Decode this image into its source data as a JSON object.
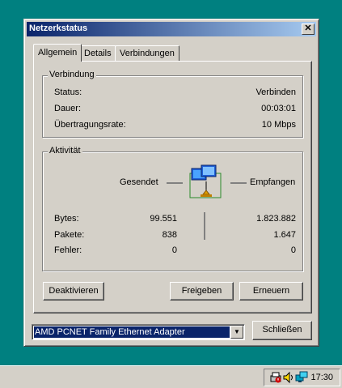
{
  "window": {
    "title": "Netzerkstatus"
  },
  "tabs": [
    {
      "label": "Allgemein"
    },
    {
      "label": "Details"
    },
    {
      "label": "Verbindungen"
    }
  ],
  "verbindung": {
    "title": "Verbindung",
    "rows": [
      {
        "label": "Status:",
        "value": "Verbinden"
      },
      {
        "label": "Dauer:",
        "value": "00:03:01"
      },
      {
        "label": "Übertragungsrate:",
        "value": "10 Mbps"
      }
    ]
  },
  "aktivitaet": {
    "title": "Aktivität",
    "sent_label": "Gesendet",
    "received_label": "Empfangen",
    "rows": [
      {
        "label": "Bytes:",
        "sent": "99.551",
        "received": "1.823.882"
      },
      {
        "label": "Pakete:",
        "sent": "838",
        "received": "1.647"
      },
      {
        "label": "Fehler:",
        "sent": "0",
        "received": "0"
      }
    ]
  },
  "buttons": {
    "deactivate": "Deaktivieren",
    "share": "Freigeben",
    "renew": "Erneuern",
    "close": "Schließen"
  },
  "adapter": {
    "selected": "AMD PCNET Family Ethernet Adapter"
  },
  "taskbar": {
    "clock": "17:30"
  },
  "colors": {
    "desktop": "#008080",
    "title_start": "#0a246a",
    "title_end": "#a6caf0",
    "face": "#d4d0c8"
  }
}
